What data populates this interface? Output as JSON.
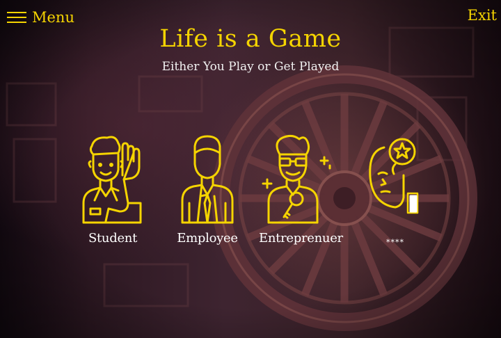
{
  "nav": {
    "menu_label": "Menu",
    "exit_label": "Exit"
  },
  "header": {
    "title": "Life is a Game",
    "subtitle": "Either You Play or Get Played"
  },
  "roles": [
    {
      "label": "Student",
      "icon": "student-icon"
    },
    {
      "label": "Employee",
      "icon": "employee-icon"
    },
    {
      "label": "Entreprenuer",
      "icon": "entrepreneur-icon"
    },
    {
      "label": "****",
      "icon": "dreamer-icon"
    }
  ],
  "colors": {
    "accent": "#f5d400",
    "text": "#ffffff",
    "background": "#2d1822"
  }
}
